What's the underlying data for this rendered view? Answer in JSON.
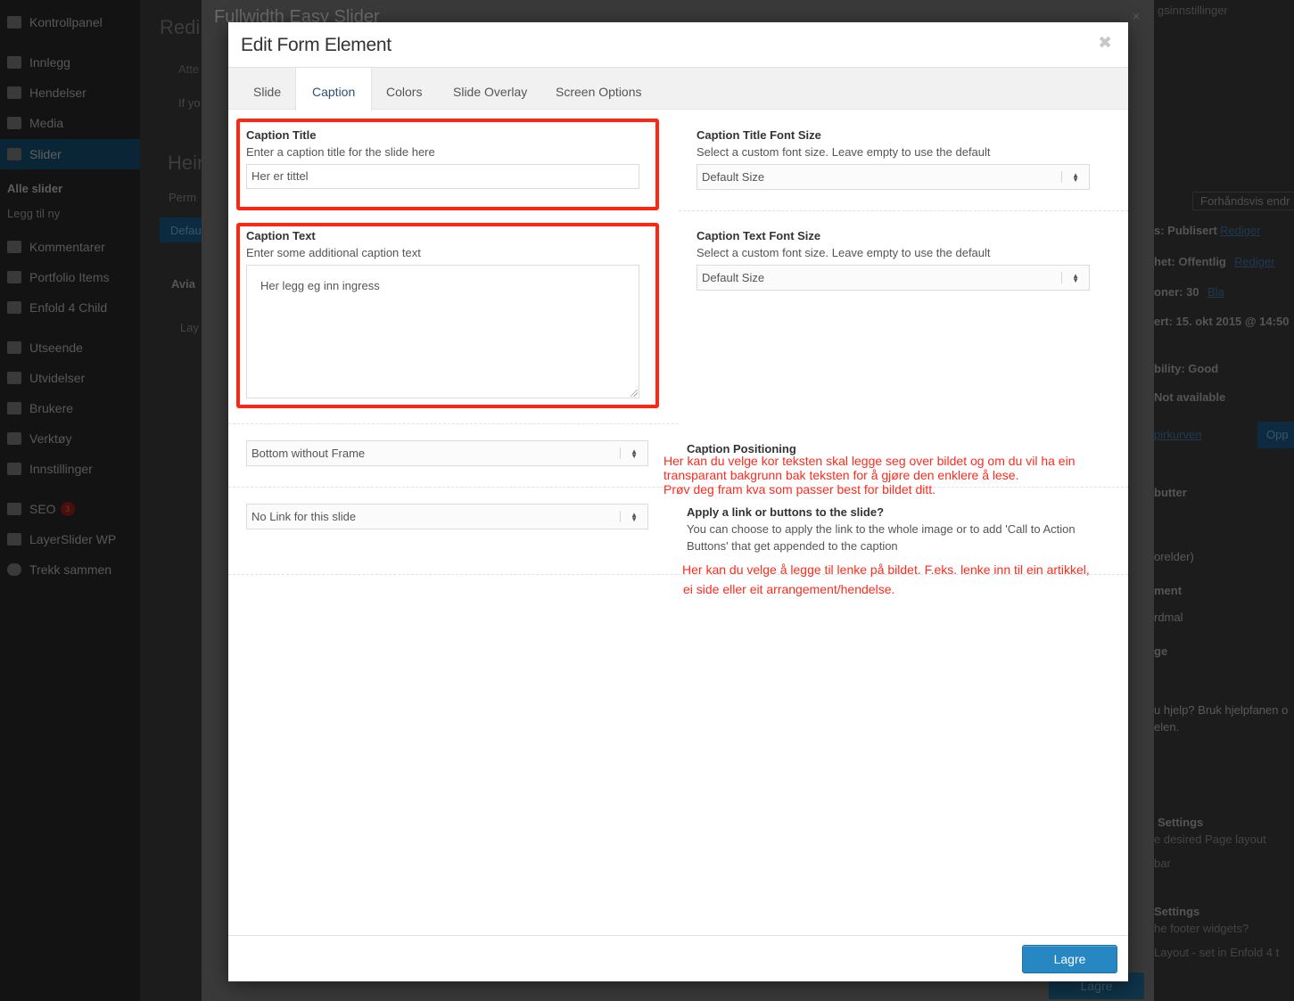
{
  "admin_menu": {
    "items": [
      {
        "label": "Kontrollpanel"
      },
      {
        "label": "Innlegg"
      },
      {
        "label": "Hendelser"
      },
      {
        "label": "Media"
      },
      {
        "label": "Slider"
      },
      {
        "label": "Alle slider"
      },
      {
        "label": "Legg til ny"
      },
      {
        "label": "Kommentarer"
      },
      {
        "label": "Portfolio Items"
      },
      {
        "label": "Enfold 4 Child"
      },
      {
        "label": "Utseende"
      },
      {
        "label": "Utvidelser"
      },
      {
        "label": "Brukere"
      },
      {
        "label": "Verktøy"
      },
      {
        "label": "Innstillinger"
      },
      {
        "label": "SEO",
        "badge": "3"
      },
      {
        "label": "LayerSlider WP"
      },
      {
        "label": "Trekk sammen"
      }
    ]
  },
  "background": {
    "page_title_fragment": "Redi",
    "heading_fragment": "Heir",
    "notice_fragment": "Atte",
    "notice_line": "If yo",
    "permalink_fragment": "Perm",
    "default_btn_fragment": "Defau",
    "avia_fragment": "Avia",
    "lay_fragment": "Lay",
    "screen_options": "gsinnstillinger",
    "preview_button": "Forhåndsvis endr",
    "publish_status_label": "s: Publisert",
    "publish_status_link": "Rediger",
    "visibility_label": "het: Offentlig",
    "visibility_link": "Rediger",
    "revisions_label": "oner: 30",
    "revisions_link": "Bla",
    "published_date": "ert: 15. okt 2015 @ 14:50",
    "readability": "bility: Good",
    "seo_status": "Not available",
    "trash_link": "pirkurven",
    "update_fragment": "Opp",
    "buttons_heading": "butter",
    "parent_select": "orelder)",
    "element_label": "ment",
    "template_select": "rdmal",
    "page_label": "ge",
    "help_text_1": "u hjelp? Bruk hjelpfanen o",
    "help_text_2": "elen.",
    "layout_settings": "Settings",
    "layout_desc": "e desired Page layout",
    "sidebar_word": "bar",
    "footer_settings": "Settings",
    "footer_desc": "he footer widgets?",
    "footer_default": "Layout - set in Enfold 4 t"
  },
  "builder": {
    "title": "Fullwidth Easy Slider",
    "close_label": "×",
    "save_label": "Lagre"
  },
  "modal": {
    "title": "Edit Form Element",
    "close_label": "✖",
    "tabs": [
      {
        "label": "Slide"
      },
      {
        "label": "Caption"
      },
      {
        "label": "Colors"
      },
      {
        "label": "Slide Overlay"
      },
      {
        "label": "Screen Options"
      }
    ],
    "active_tab": "Caption",
    "caption_title": {
      "label": "Caption Title",
      "description": "Enter a caption title for the slide here",
      "value": "Her er tittel"
    },
    "caption_title_font_size": {
      "label": "Caption Title Font Size",
      "description": "Select a custom font size. Leave empty to use the default",
      "selected": "Default Size"
    },
    "caption_text": {
      "label": "Caption Text",
      "description": "Enter some additional caption text",
      "value": "Her legg eg inn ingress"
    },
    "caption_text_font_size": {
      "label": "Caption Text Font Size",
      "description": "Select a custom font size. Leave empty to use the default",
      "selected": "Default Size"
    },
    "caption_positioning": {
      "label": "Caption Positioning",
      "selected": "Bottom without Frame"
    },
    "link": {
      "label": "Apply a link or buttons to the slide?",
      "description_line1": "You can choose to apply the link to the whole image or to add 'Call to Action",
      "description_line2": "Buttons' that get appended to the caption",
      "selected": "No Link for this slide"
    },
    "save_label": "Lagre"
  },
  "annotations": {
    "positioning_note_1": "Her kan du velge kor teksten skal legge seg over bildet og om du vil ha ein",
    "positioning_note_2": "transparant bakgrunn bak teksten for å gjøre den enklere å lese.",
    "positioning_note_3": "Prøv deg fram kva som passer best for bildet ditt.",
    "link_note_1": "Her kan du velge å legge til lenke på bildet. F.eks. lenke inn til ein artikkel,",
    "link_note_2": "ei side eller eit arrangement/hendelse.",
    "highlight_color": "#ff2712"
  },
  "colors": {
    "primary_button": "#2687c3",
    "active_tab_text": "#2a5073",
    "annotation_red": "#ff2b1d"
  }
}
